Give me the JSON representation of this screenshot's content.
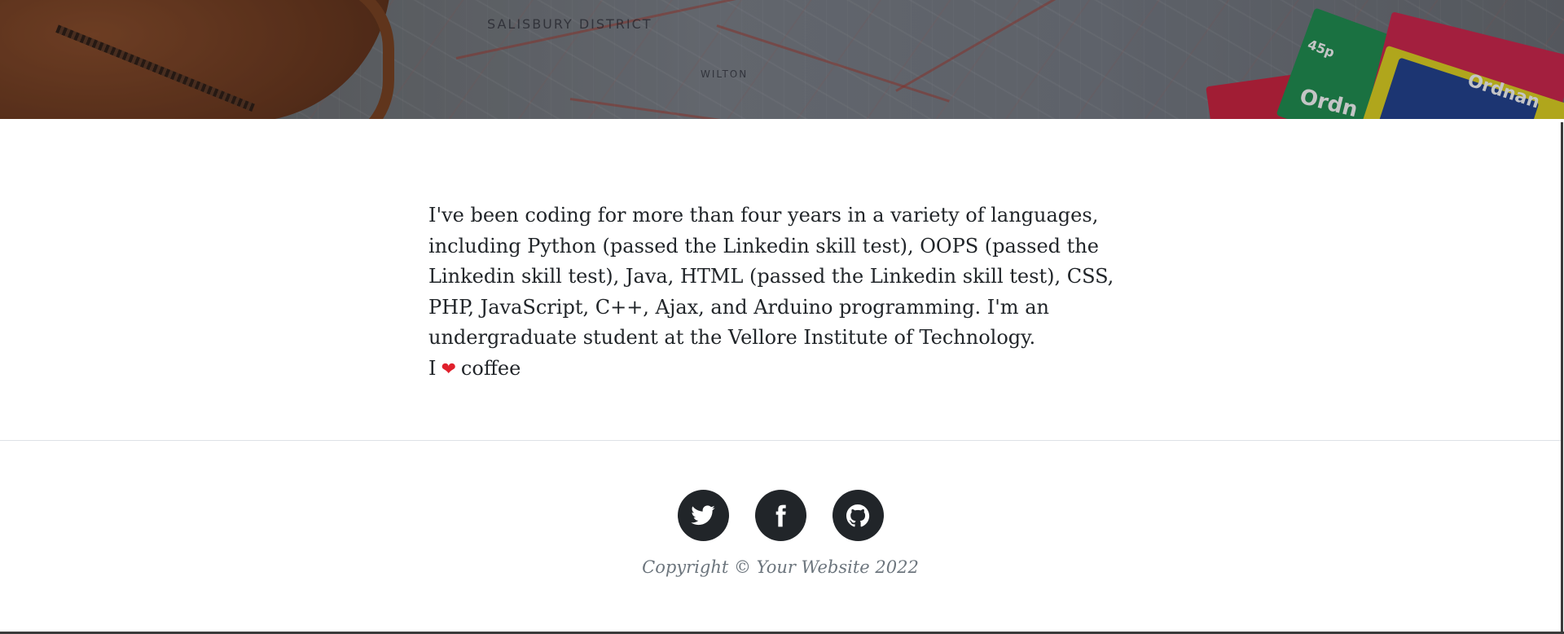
{
  "hero": {
    "map_labels": [
      "SALISBURY DISTRICT",
      "WILTON"
    ],
    "book_labels": [
      "45p",
      "Ordn",
      "Ordnan"
    ]
  },
  "about": {
    "paragraph": "I've been coding for more than four years in a variety of languages, including Python (passed the Linkedin skill test), OOPS (passed the Linkedin skill test), Java, HTML (passed the Linkedin skill test), CSS, PHP, JavaScript, C++, Ajax, and Arduino programming. I'm an undergraduate student at the Vellore Institute of Technology.",
    "love_prefix": "I",
    "love_icon": "heart-icon",
    "love_suffix": "coffee"
  },
  "footer": {
    "social_links": [
      {
        "name": "twitter",
        "icon": "twitter-icon"
      },
      {
        "name": "facebook",
        "icon": "facebook-icon"
      },
      {
        "name": "github",
        "icon": "github-icon"
      }
    ],
    "copyright": "Copyright © Your Website 2022"
  },
  "colors": {
    "text": "#212529",
    "muted": "#6c757d",
    "social_bg": "#212529",
    "heart": "#e0202c",
    "divider": "#dee2e6"
  }
}
